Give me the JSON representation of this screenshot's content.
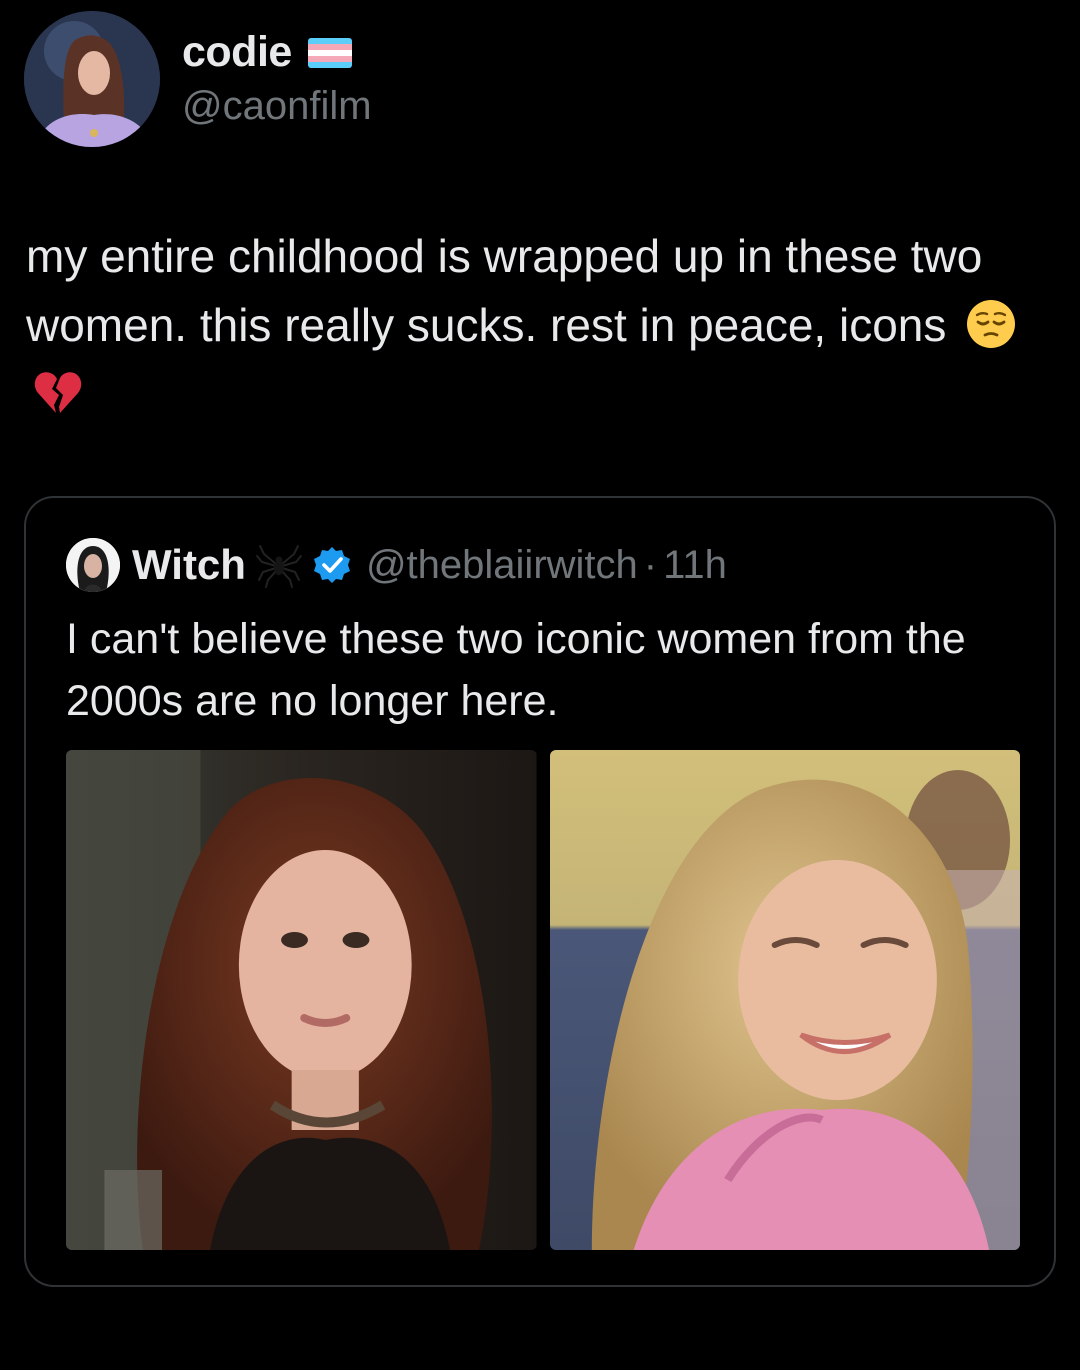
{
  "tweet": {
    "author": {
      "display_name": "codie",
      "handle": "@caonfilm",
      "flag_icon": "transgender-flag-icon",
      "flag_colors": [
        "#5bcefa",
        "#f5a9b8",
        "#ffffff",
        "#f5a9b8",
        "#5bcefa"
      ]
    },
    "text": "my entire childhood is wrapped up in these two women. this really sucks. rest in peace, icons",
    "emojis": [
      "pensive-face-icon",
      "broken-heart-icon"
    ]
  },
  "quoted_tweet": {
    "author": {
      "display_name": "Witch",
      "handle": "@theblaiirwitch",
      "separator": "·",
      "time": "11h",
      "name_emoji": "spider-icon",
      "verified_icon": "verified-badge-icon",
      "verified_color": "#1d9bf0"
    },
    "text": "I can't believe these two iconic women from the 2000s are no longer here.",
    "media": [
      "photo-woman-dark-red-hair",
      "photo-woman-blonde-pink-hoodie"
    ]
  },
  "colors": {
    "background": "#000000",
    "text_primary": "#e7e9ea",
    "text_secondary": "#71767b",
    "card_border": "#2f3336"
  }
}
